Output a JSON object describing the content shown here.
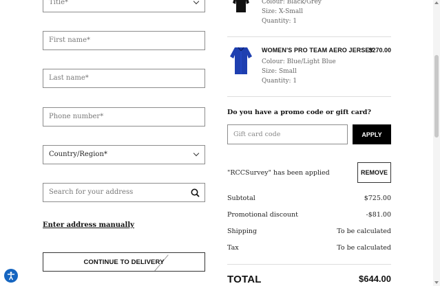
{
  "form": {
    "title_placeholder": "Title*",
    "first_name_placeholder": "First name*",
    "last_name_placeholder": "Last name*",
    "phone_placeholder": "Phone number*",
    "country_placeholder": "Country/Region*",
    "address_search_placeholder": "Search for your address",
    "enter_manually_link": "Enter address manually",
    "continue_button": "CONTINUE TO DELIVERY"
  },
  "cart": {
    "items": [
      {
        "name": "",
        "price": "",
        "colour": "Colour: Black/Grey",
        "size": "Size: X-Small",
        "quantity": "Quantity: 1",
        "color": "#111111"
      },
      {
        "name": "WOMEN'S PRO TEAM AERO JERSEY",
        "price": "$270.00",
        "colour": "Colour: Blue/Light Blue",
        "size": "Size: Small",
        "quantity": "Quantity: 1",
        "color": "#1e3fb0"
      }
    ],
    "promo_question": "Do you have a promo code or gift card?",
    "gift_card_placeholder": "Gift card code",
    "apply_button": "APPLY",
    "applied_message": "\"RCCSurvey\" has been applied",
    "remove_button": "REMOVE",
    "summary": {
      "subtotal_label": "Subtotal",
      "subtotal_value": "$725.00",
      "promo_label": "Promotional discount",
      "promo_value": "-$81.00",
      "shipping_label": "Shipping",
      "shipping_value": "To be calculated",
      "tax_label": "Tax",
      "tax_value": "To be calculated",
      "total_label": "TOTAL",
      "total_value": "$644.00"
    }
  },
  "icons": {
    "accessibility": "accessibility-icon",
    "search": "search-icon",
    "chevron": "chevron-down-icon"
  }
}
